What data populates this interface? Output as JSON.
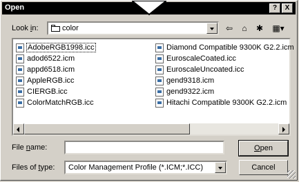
{
  "window": {
    "title": "Open",
    "help_label": "?",
    "close_label": "X"
  },
  "lookin": {
    "label_prefix": "Look ",
    "label_ul": "i",
    "label_suffix": "n:",
    "value": "color"
  },
  "files": {
    "col1": [
      "AdobeRGB1998.icc",
      "adod6522.icm",
      "appd6518.icm",
      "AppleRGB.icc",
      "CIERGB.icc",
      "ColorMatchRGB.icc"
    ],
    "col2": [
      "Diamond Compatible 9300K G2.2.icm",
      "EuroscaleCoated.icc",
      "EuroscaleUncoated.icc",
      "gend9318.icm",
      "gend9322.icm",
      "Hitachi Compatible 9300K G2.2.icm"
    ]
  },
  "filename": {
    "label_prefix": "File ",
    "label_ul": "n",
    "label_suffix": "ame:",
    "value": ""
  },
  "filetype": {
    "label_prefix": "Files of ",
    "label_ul": "t",
    "label_suffix": "ype:",
    "value": "Color Management Profile (*.ICM;*.ICC)"
  },
  "buttons": {
    "open_ul": "O",
    "open_rest": "pen",
    "cancel": "Cancel"
  }
}
